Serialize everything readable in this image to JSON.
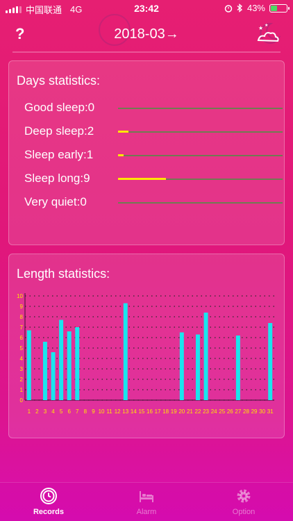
{
  "status_bar": {
    "carrier": "中国联通",
    "network": "4G",
    "time": "23:42",
    "battery_percent": "43%",
    "battery_level": 0.43
  },
  "header": {
    "help_label": "?",
    "month_title": "2018-03→",
    "help_icon": "question-mark-icon",
    "sleep_mode_icon": "moon-cloud-icon"
  },
  "days_statistics": {
    "title": "Days statistics:",
    "max_scale": 31,
    "items": [
      {
        "label": "Good sleep:0",
        "value": 0
      },
      {
        "label": "Deep sleep:2",
        "value": 2
      },
      {
        "label": "Sleep early:1",
        "value": 1
      },
      {
        "label": "Sleep long:9",
        "value": 9
      },
      {
        "label": "Very quiet:0",
        "value": 0
      }
    ]
  },
  "length_statistics": {
    "title": "Length statistics:"
  },
  "chart_data": {
    "type": "bar",
    "title": "Length statistics:",
    "categories": [
      "1",
      "2",
      "3",
      "4",
      "5",
      "6",
      "7",
      "8",
      "9",
      "10",
      "11",
      "12",
      "13",
      "14",
      "15",
      "16",
      "17",
      "18",
      "19",
      "20",
      "21",
      "22",
      "23",
      "24",
      "25",
      "26",
      "27",
      "28",
      "29",
      "30",
      "31"
    ],
    "values": [
      6.7,
      0,
      5.6,
      4.6,
      7.7,
      6.6,
      7.0,
      0,
      0,
      0,
      0,
      0,
      9.3,
      0,
      0,
      0,
      0,
      0,
      0,
      6.5,
      0,
      6.3,
      8.4,
      0,
      0,
      0,
      6.2,
      0,
      0,
      0,
      7.4
    ],
    "y_ticks": [
      "0",
      "1",
      "2",
      "3",
      "4",
      "5",
      "6",
      "7",
      "8",
      "9",
      "10"
    ],
    "ylim": [
      0,
      10
    ],
    "bar_color": "#19e6ee",
    "tick_color": "#ffe600",
    "grid": true
  },
  "tab_bar": {
    "tabs": [
      {
        "label": "Records",
        "icon": "clock-icon",
        "active": true
      },
      {
        "label": "Alarm",
        "icon": "bed-icon",
        "active": false
      },
      {
        "label": "Option",
        "icon": "gear-icon",
        "active": false
      }
    ]
  },
  "colors": {
    "accent_yellow": "#ffe600",
    "bar_cyan": "#19e6ee",
    "track_gray": "#707b52"
  }
}
